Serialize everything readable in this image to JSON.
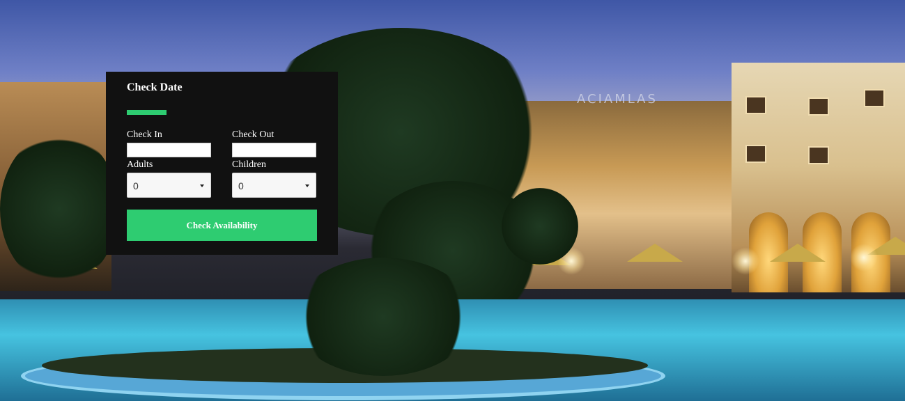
{
  "booking": {
    "title": "Check Date",
    "accent_color": "#2ecc71",
    "check_in": {
      "label": "Check In",
      "value": ""
    },
    "check_out": {
      "label": "Check Out",
      "value": ""
    },
    "adults": {
      "label": "Adults",
      "selected": "0"
    },
    "children": {
      "label": "Children",
      "selected": "0"
    },
    "submit_label": "Check Availability"
  },
  "background": {
    "sign_text": "ACIAMLAS"
  }
}
